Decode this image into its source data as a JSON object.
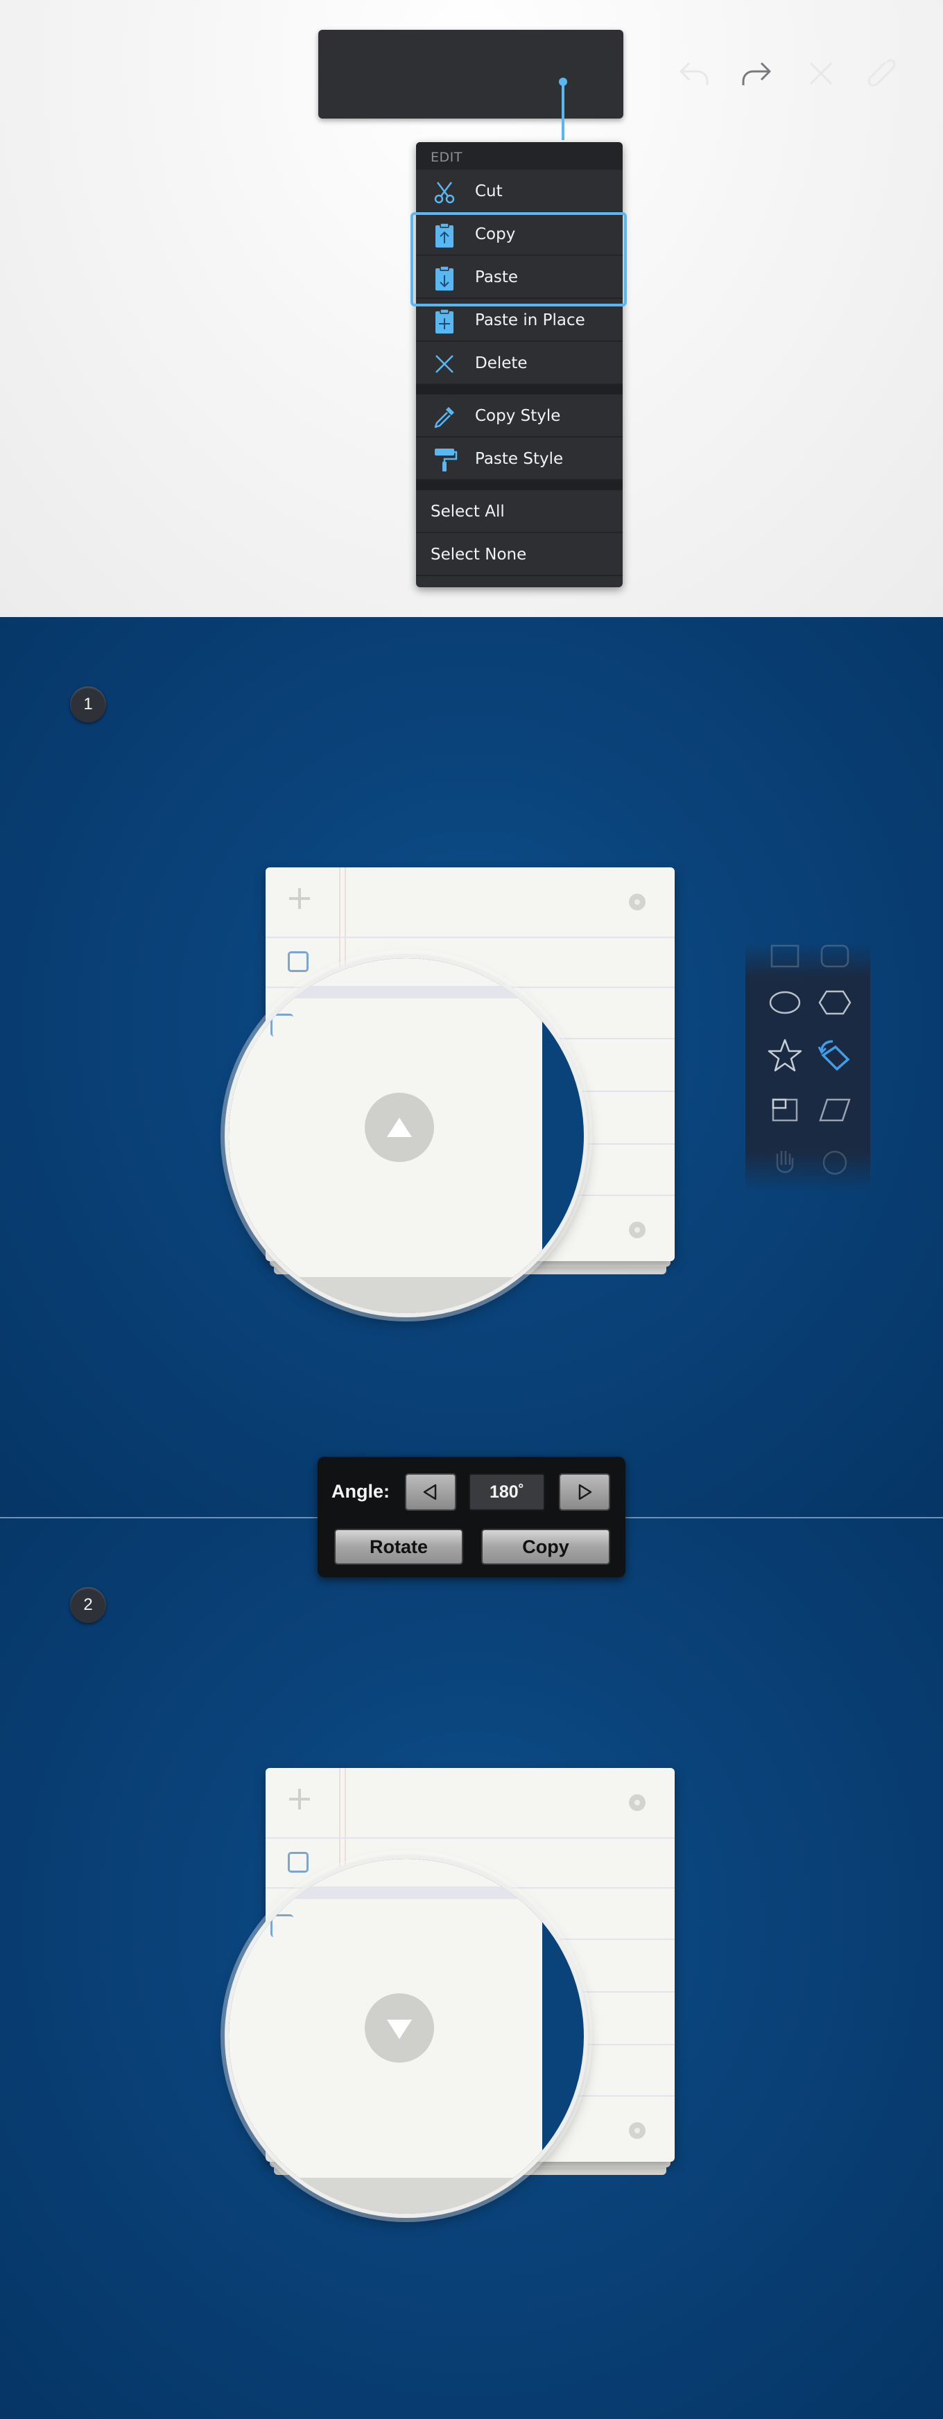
{
  "toolbar": {
    "buttons": [
      {
        "icon": "undo-icon"
      },
      {
        "icon": "redo-icon",
        "disabled": true
      },
      {
        "icon": "close-icon"
      },
      {
        "icon": "paperclip-icon"
      }
    ]
  },
  "edit_menu": {
    "header": "EDIT",
    "items": [
      {
        "label": "Cut",
        "icon": "scissors-icon"
      },
      {
        "label": "Copy",
        "icon": "clipboard-up-icon",
        "highlighted": true
      },
      {
        "label": "Paste",
        "icon": "clipboard-down-icon",
        "highlighted": true
      },
      {
        "label": "Paste in Place",
        "icon": "clipboard-plus-icon"
      },
      {
        "label": "Delete",
        "icon": "x-icon"
      },
      {
        "label": "Copy Style",
        "icon": "eyedropper-icon"
      },
      {
        "label": "Paste Style",
        "icon": "paint-roller-icon"
      },
      {
        "label": "Select All"
      },
      {
        "label": "Select None"
      }
    ],
    "accent_color": "#59b8f1"
  },
  "steps": [
    {
      "number": "1",
      "arrow": "up"
    },
    {
      "number": "2",
      "arrow": "down"
    }
  ],
  "shapes_panel": {
    "shapes": [
      "rect-icon",
      "rounded-rect-icon",
      "ellipse-icon",
      "hexagon-icon",
      "star-icon",
      "rotate-shape-icon",
      "frame-icon",
      "parallelogram-icon",
      "hand-icon",
      "circle-icon"
    ],
    "selected": "rotate-shape-icon"
  },
  "angle_panel": {
    "label": "Angle:",
    "value": "180˚",
    "decrement_icon": "triangle-left-icon",
    "increment_icon": "triangle-right-icon",
    "rotate_label": "Rotate",
    "copy_label": "Copy"
  },
  "colors": {
    "background_blue": "#0a437a",
    "menu_dark": "#2e2f33",
    "highlight": "#59b8f1"
  }
}
